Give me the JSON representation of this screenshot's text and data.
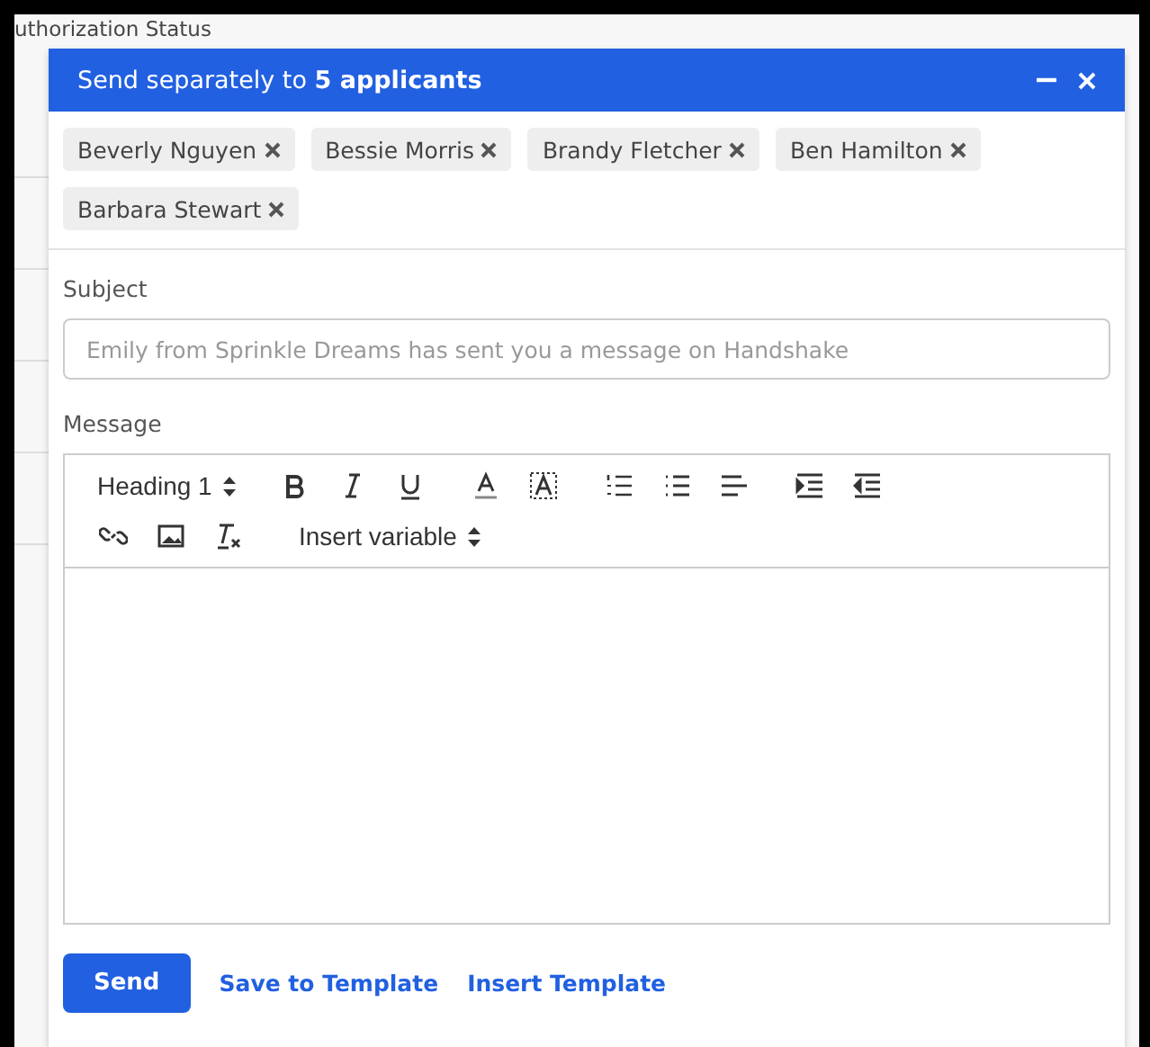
{
  "background": {
    "column_heading": "uthorization Status"
  },
  "dialog": {
    "title": "Send separately to **5 applicants**",
    "recipients": [
      {
        "name": "Beverly Nguyen"
      },
      {
        "name": "Bessie Morris"
      },
      {
        "name": "Brandy Fletcher"
      },
      {
        "name": "Ben Hamilton"
      },
      {
        "name": "Barbara Stewart"
      }
    ],
    "subject": {
      "label": "Subject",
      "placeholder": "Emily from Sprinkle Dreams has sent you a message on Handshake"
    },
    "message": {
      "label": "Message",
      "heading_select": "Heading 1",
      "variable_select": "Insert variable"
    },
    "buttons": [
      {
        "kind": "primary",
        "label": "Send"
      },
      {
        "kind": "link",
        "label": "Save to Template"
      },
      {
        "kind": "link",
        "label": "Insert Template"
      }
    ]
  }
}
